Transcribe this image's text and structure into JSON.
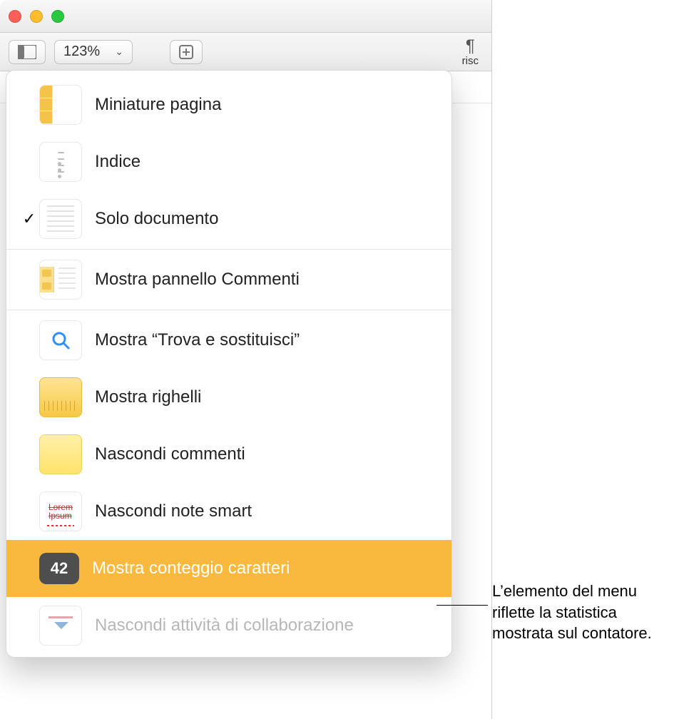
{
  "toolbar": {
    "zoom_value": "123%",
    "right_label": "risc"
  },
  "menu": {
    "items": [
      {
        "label": "Miniature pagina",
        "checked": false
      },
      {
        "label": "Indice",
        "checked": false
      },
      {
        "label": "Solo documento",
        "checked": true
      },
      {
        "label": "Mostra pannello Commenti",
        "checked": false
      },
      {
        "label": "Mostra “Trova e sostituisci”",
        "checked": false
      },
      {
        "label": "Mostra righelli",
        "checked": false
      },
      {
        "label": "Nascondi commenti",
        "checked": false
      },
      {
        "label": "Nascondi note smart",
        "checked": false
      },
      {
        "label": "Mostra conteggio caratteri",
        "checked": false,
        "selected": true,
        "count": "42"
      },
      {
        "label": "Nascondi attività di collaborazione",
        "checked": false,
        "disabled": true
      }
    ]
  },
  "callout": "L’elemento del menu riflette la statistica mostrata sul contatore."
}
